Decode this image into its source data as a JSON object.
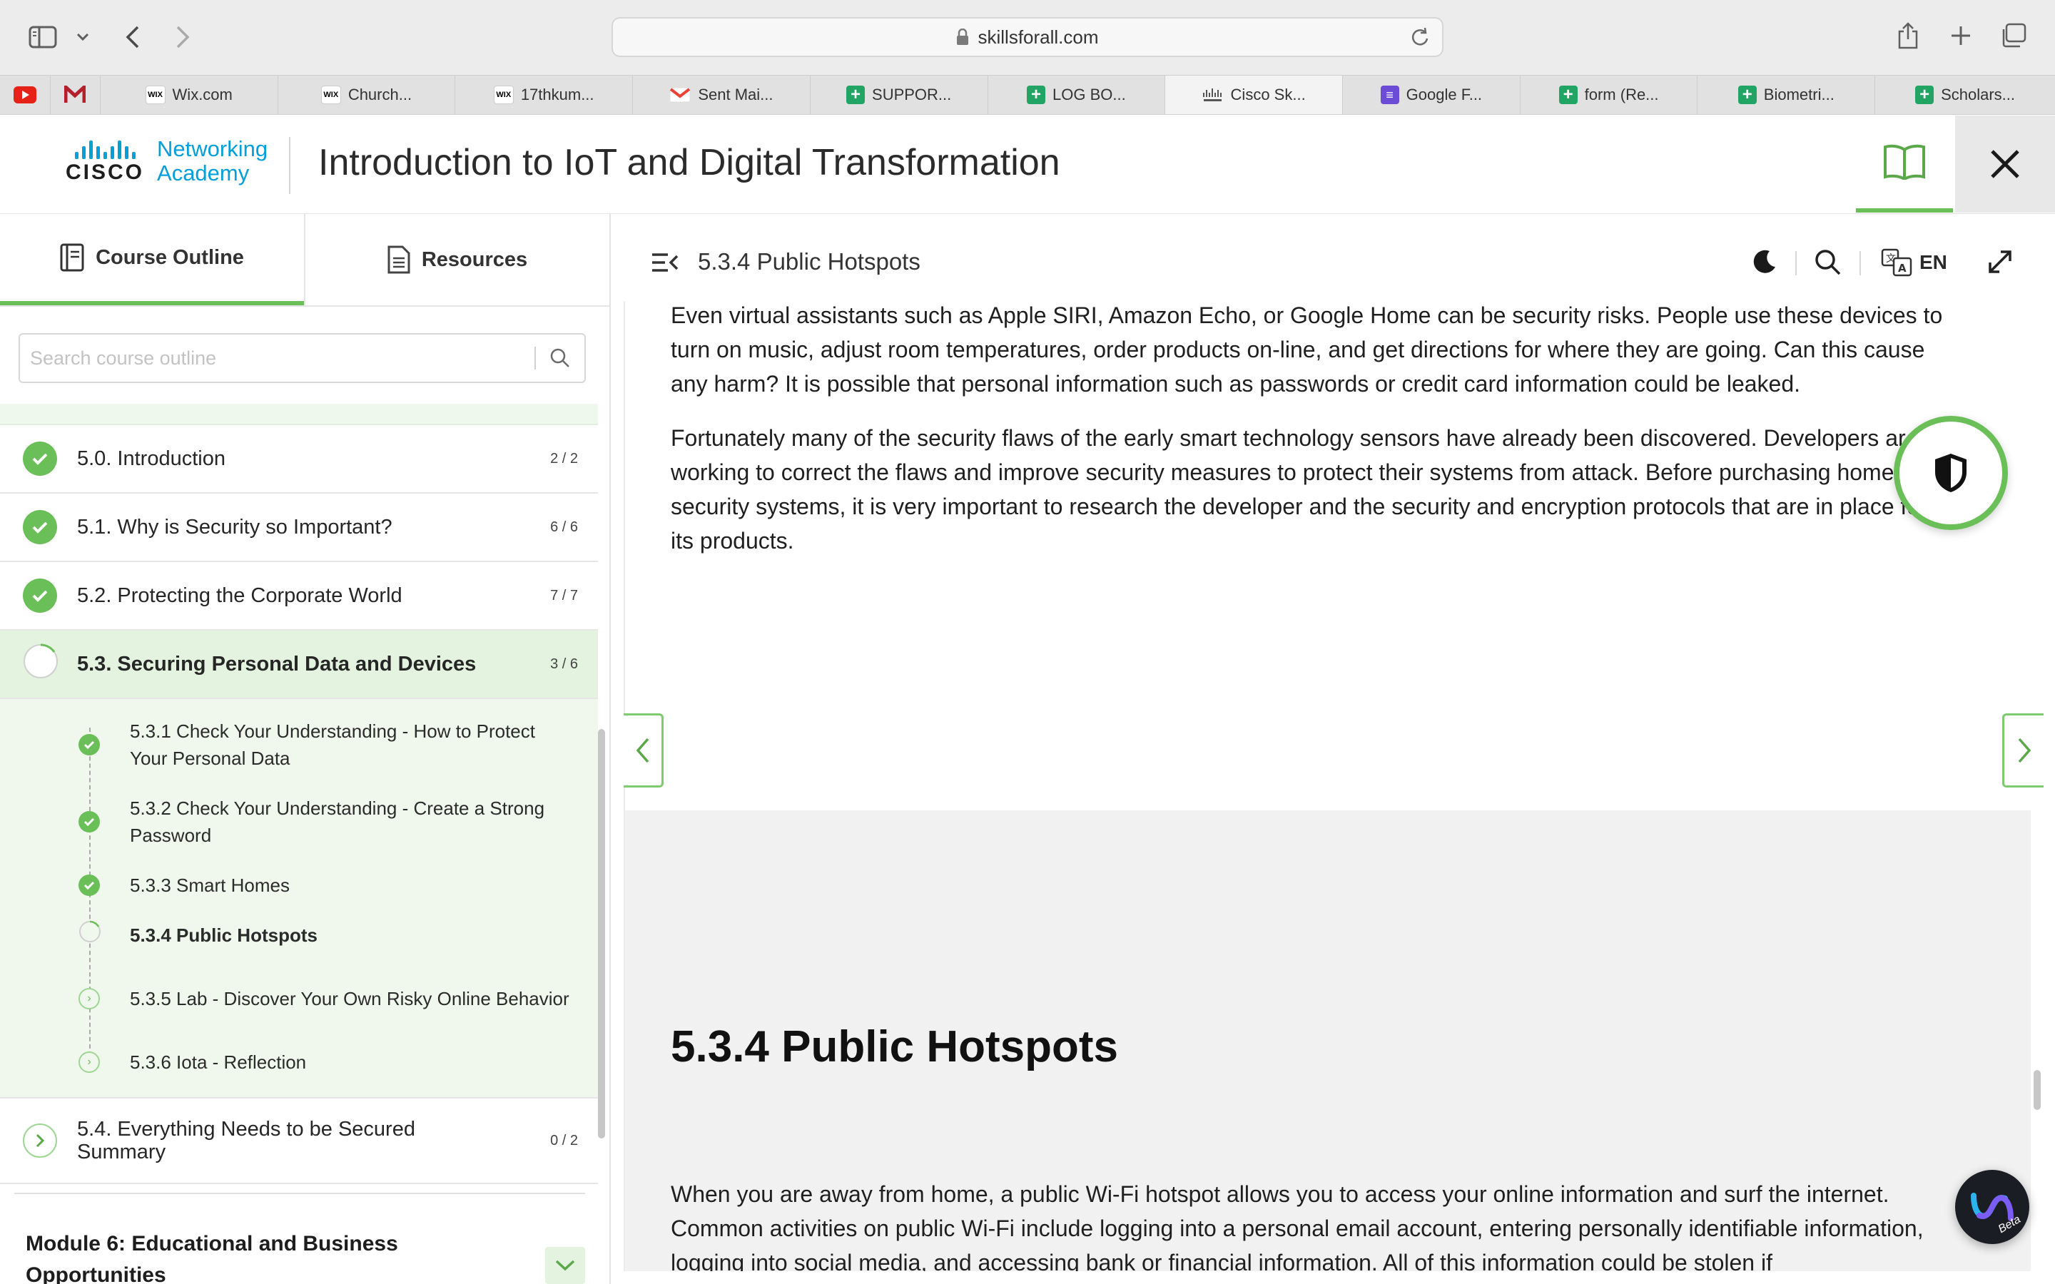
{
  "browser": {
    "url": "skillsforall.com",
    "tabs": [
      {
        "label": "Wix.com",
        "favicon": "wix"
      },
      {
        "label": "Church...",
        "favicon": "wix"
      },
      {
        "label": "17thkum...",
        "favicon": "wix"
      },
      {
        "label": "Sent Mai...",
        "favicon": "gmail"
      },
      {
        "label": "SUPPOR...",
        "favicon": "sheets"
      },
      {
        "label": "LOG BO...",
        "favicon": "sheets"
      },
      {
        "label": "Cisco Sk...",
        "favicon": "cisco"
      },
      {
        "label": "Google F...",
        "favicon": "forms"
      },
      {
        "label": "form (Re...",
        "favicon": "sheets"
      },
      {
        "label": "Biometri...",
        "favicon": "sheets"
      },
      {
        "label": "Scholars...",
        "favicon": "sheets"
      }
    ]
  },
  "header": {
    "logo_word": "CISCO",
    "logo_line1": "Networking",
    "logo_line2": "Academy",
    "course_title": "Introduction to IoT and Digital Transformation"
  },
  "sidebar": {
    "tabs": [
      {
        "label": "Course Outline",
        "icon": "outline-icon"
      },
      {
        "label": "Resources",
        "icon": "document-icon"
      }
    ],
    "search_placeholder": "Search course outline",
    "sections": [
      {
        "label": "5.0. Introduction",
        "count": "2 / 2",
        "status": "complete"
      },
      {
        "label": "5.1. Why is Security so Important?",
        "count": "6 / 6",
        "status": "complete"
      },
      {
        "label": "5.2. Protecting the Corporate World",
        "count": "7 / 7",
        "status": "complete"
      },
      {
        "label": "5.3. Securing Personal Data and Devices",
        "count": "3 / 6",
        "status": "in-progress"
      }
    ],
    "subitems": [
      {
        "label": "5.3.1 Check Your Understanding - How to Protect Your Personal Data",
        "status": "complete"
      },
      {
        "label": "5.3.2 Check Your Understanding - Create a Strong Password",
        "status": "complete"
      },
      {
        "label": "5.3.3 Smart Homes",
        "status": "complete"
      },
      {
        "label": "5.3.4 Public Hotspots",
        "status": "current"
      },
      {
        "label": "5.3.5 Lab - Discover Your Own Risky Online Behavior",
        "status": "not-started"
      },
      {
        "label": "5.3.6 Iota - Reflection",
        "status": "not-started"
      }
    ],
    "next_section": {
      "label": "5.4. Everything Needs to be Secured Summary",
      "count": "0 / 2",
      "status": "not-started"
    },
    "module6_label": "Module 6: Educational and Business Opportunities"
  },
  "content": {
    "page_title": "5.3.4 Public Hotspots",
    "language": "EN",
    "paragraph1": "Even virtual assistants such as Apple SIRI, Amazon Echo, or Google Home can be security risks. People use these devices to turn on music, adjust room temperatures, order products on-line, and get directions for where they are going. Can this cause any harm? It is possible that personal information such as passwords or credit card information could be leaked.",
    "paragraph2": "Fortunately many of the security flaws of the early smart technology sensors have already been discovered. Developers are working to correct the flaws and improve security measures to protect their systems from attack. Before purchasing home security systems, it is very important to research the developer and the security and encryption protocols that are in place for its products.",
    "section_heading": "5.3.4 Public Hotspots",
    "paragraph3": "When you are away from home, a public Wi-Fi hotspot allows you to access your online information and surf the internet. Common activities on public Wi-Fi include logging into a personal email account, entering personally identifiable information, logging into social media, and accessing bank or financial information. All of this information could be stolen if"
  },
  "webex_badge": "Beta",
  "colors": {
    "accent": "#6bbf59",
    "cisco_blue": "#049fd9"
  }
}
